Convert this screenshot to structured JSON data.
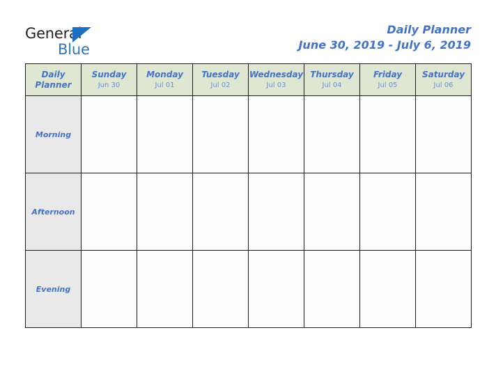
{
  "brand": {
    "word_one": "General",
    "word_two": "Blue",
    "triangle_icon": "triangle-logo-icon",
    "colors": {
      "dark_text": "#231f20",
      "blue_text": "#2e75b6",
      "triangle": "#1b6ec2"
    }
  },
  "header": {
    "title": "Daily Planner",
    "date_range": "June 30, 2019 - July 6, 2019",
    "title_color": "#4472c4"
  },
  "table": {
    "corner": {
      "line_one": "Daily",
      "line_two": "Planner"
    },
    "columns": [
      {
        "day": "Sunday",
        "date": "Jun 30"
      },
      {
        "day": "Monday",
        "date": "Jul 01"
      },
      {
        "day": "Tuesday",
        "date": "Jul 02"
      },
      {
        "day": "Wednesday",
        "date": "Jul 03"
      },
      {
        "day": "Thursday",
        "date": "Jul 04"
      },
      {
        "day": "Friday",
        "date": "Jul 05"
      },
      {
        "day": "Saturday",
        "date": "Jul 06"
      }
    ],
    "rows": [
      {
        "period": "Morning",
        "cells": [
          "",
          "",
          "",
          "",
          "",
          "",
          ""
        ]
      },
      {
        "period": "Afternoon",
        "cells": [
          "",
          "",
          "",
          "",
          "",
          "",
          ""
        ]
      },
      {
        "period": "Evening",
        "cells": [
          "",
          "",
          "",
          "",
          "",
          "",
          ""
        ]
      }
    ],
    "colors": {
      "header_bg": "#dfe7d2",
      "period_bg": "#e9e9e9",
      "slot_bg": "#fdfdfd",
      "border": "#1a1a1a"
    }
  }
}
